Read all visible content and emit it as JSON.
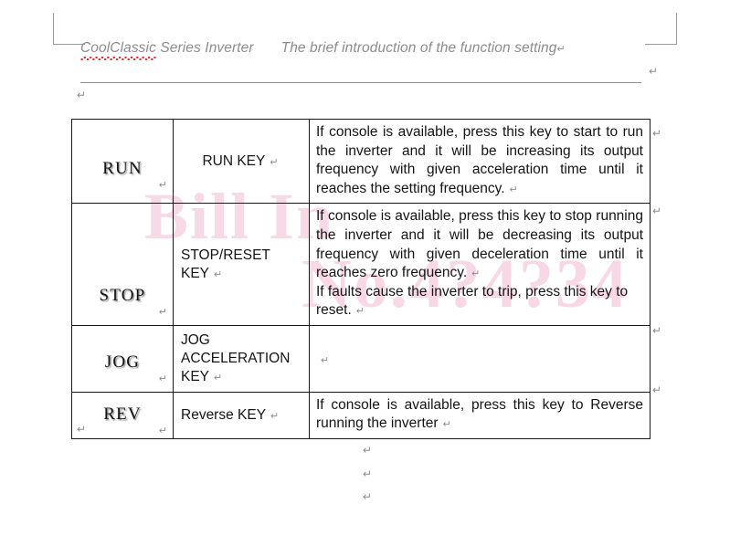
{
  "document": {
    "header": {
      "title_spell": "CoolClassic",
      "title_rest": " Series Inverter",
      "subtitle": "The brief introduction of the function setting",
      "return_mark": "↵"
    },
    "watermark": {
      "line1": "Bill In",
      "line2": "No.4?4?34",
      "color": "#f3bcd2"
    },
    "marks": {
      "return": "↵",
      "header_right": "↵",
      "below_header": "↵",
      "below_table": "↵",
      "footer_1": "↵",
      "footer_2": "↵",
      "footer_3": "↵"
    },
    "table": {
      "rows": [
        {
          "key": "RUN",
          "name": "RUN KEY",
          "desc": [
            "If console is available, press this key to start to run the inverter and it will be increasing its output frequency with given acceleration time until it reaches the setting frequency."
          ],
          "row_return": "↵"
        },
        {
          "key": "STOP",
          "name": "STOP/RESET KEY",
          "desc": [
            "If console is available, press this key to stop running the inverter and it will be decreasing its output frequency with given deceleration time until it reaches zero frequency.",
            "If faults cause the inverter to trip, press this key to reset."
          ],
          "row_return": "↵"
        },
        {
          "key": "JOG",
          "name": "JOG ACCELERATION KEY",
          "desc": [],
          "row_return": "↵"
        },
        {
          "key": "REV",
          "name": "Reverse KEY",
          "desc": [
            "If console is available, press this key to Reverse running the inverter"
          ],
          "row_return": "↵"
        }
      ]
    }
  }
}
